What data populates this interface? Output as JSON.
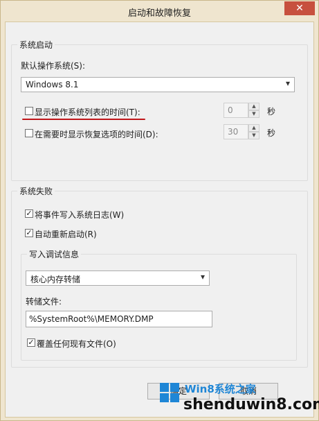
{
  "window": {
    "title": "启动和故障恢复",
    "close_glyph": "✕"
  },
  "startup": {
    "group_title": "系统启动",
    "default_os_label": "默认操作系统(S):",
    "default_os_value": "Windows 8.1",
    "show_os_list": {
      "label": "显示操作系统列表的时间(T):",
      "checked": false,
      "value": "0",
      "unit": "秒"
    },
    "show_recovery": {
      "label": "在需要时显示恢复选项的时间(D):",
      "checked": false,
      "value": "30",
      "unit": "秒"
    }
  },
  "failure": {
    "group_title": "系统失败",
    "write_event": {
      "label": "将事件写入系统日志(W)",
      "checked": true
    },
    "auto_restart": {
      "label": "自动重新启动(R)",
      "checked": true
    },
    "debug": {
      "group_title": "写入调试信息",
      "dump_type": "核心内存转储",
      "dump_file_label": "转储文件:",
      "dump_file_value": "%SystemRoot%\\MEMORY.DMP",
      "overwrite": {
        "label": "覆盖任何现有文件(O)",
        "checked": true
      }
    }
  },
  "buttons": {
    "ok": "确定",
    "cancel": "取消"
  },
  "watermark": {
    "top": "Win8系统之家",
    "bottom": "shenduwin8.com"
  },
  "colors": {
    "annotation_underline": "#c0161a",
    "watermark_blue": "#1f86d6"
  },
  "icons": {
    "chevron": "▾",
    "check": "✓",
    "spin_up": "▲",
    "spin_down": "▼"
  }
}
